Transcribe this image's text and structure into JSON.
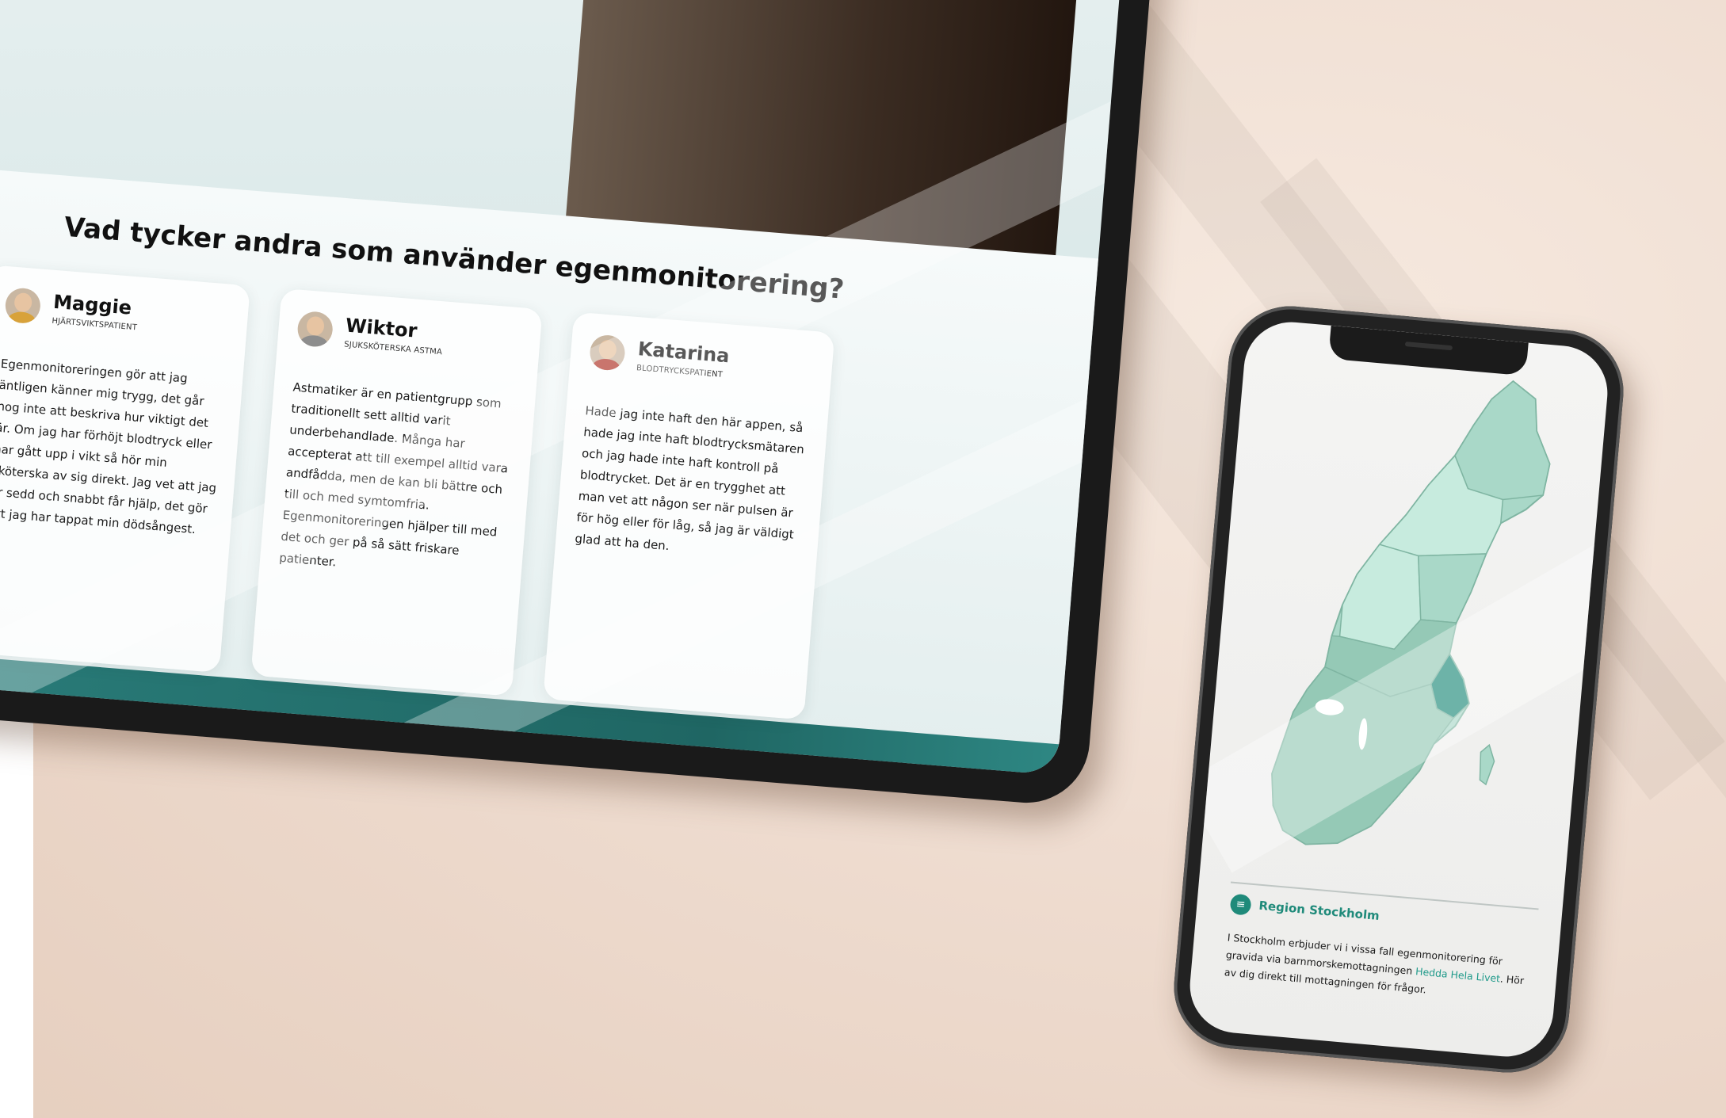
{
  "tablet": {
    "section_title": "Vad tycker andra som använder egenmonitorering?",
    "testimonials": [
      {
        "name": "Maggie",
        "role": "HJÄRTSVIKTSPATIENT",
        "quote": "Egenmonitoreringen gör att jag äntligen känner mig trygg, det går nog inte att beskriva hur viktigt det är. Om jag har förhöjt blodtryck eller har gått upp i vikt så hör min sköterska av sig direkt. Jag vet att jag är sedd och snabbt får hjälp, det gör att jag har tappat min dödsångest.",
        "avatar_color": "#d8a23a"
      },
      {
        "name": "Wiktor",
        "role": "SJUKSKÖTERSKA ASTMA",
        "quote": "Astmatiker är en patientgrupp som traditionellt sett alltid varit underbehandlade. Många har accepterat att till exempel alltid vara andfådda, men de kan bli bättre och till och med symtomfria. Egenmonitoreringen hjälper till med det och ger på så sätt friskare patienter.",
        "avatar_color": "#8d8d8d"
      },
      {
        "name": "Katarina",
        "role": "BLODTRYCKSPATIENT",
        "quote": "Hade jag inte haft den här appen, så hade jag inte haft blodtrycksmätaren och jag hade inte haft kontroll på blodtrycket. Det är en trygghet att man vet att någon ser när pulsen är för hög eller för låg, så jag är väldigt glad att ha den.",
        "avatar_color": "#b23a2e"
      }
    ]
  },
  "phone": {
    "region_label": "Region Stockholm",
    "region_text_before": "I Stockholm erbjuder vi i vissa fall egenmonitorering för gravida via barnmorskemottagningen ",
    "region_link": "Hedda Hela Livet",
    "region_text_after": ". Hör av dig direkt till mottagningen för frågor.",
    "map_colors": {
      "base": "#a9d8c8",
      "light": "#c7ebde",
      "mid": "#95c9b6",
      "highlight": "#1f8a7a",
      "border": "#7fb5a2"
    }
  }
}
